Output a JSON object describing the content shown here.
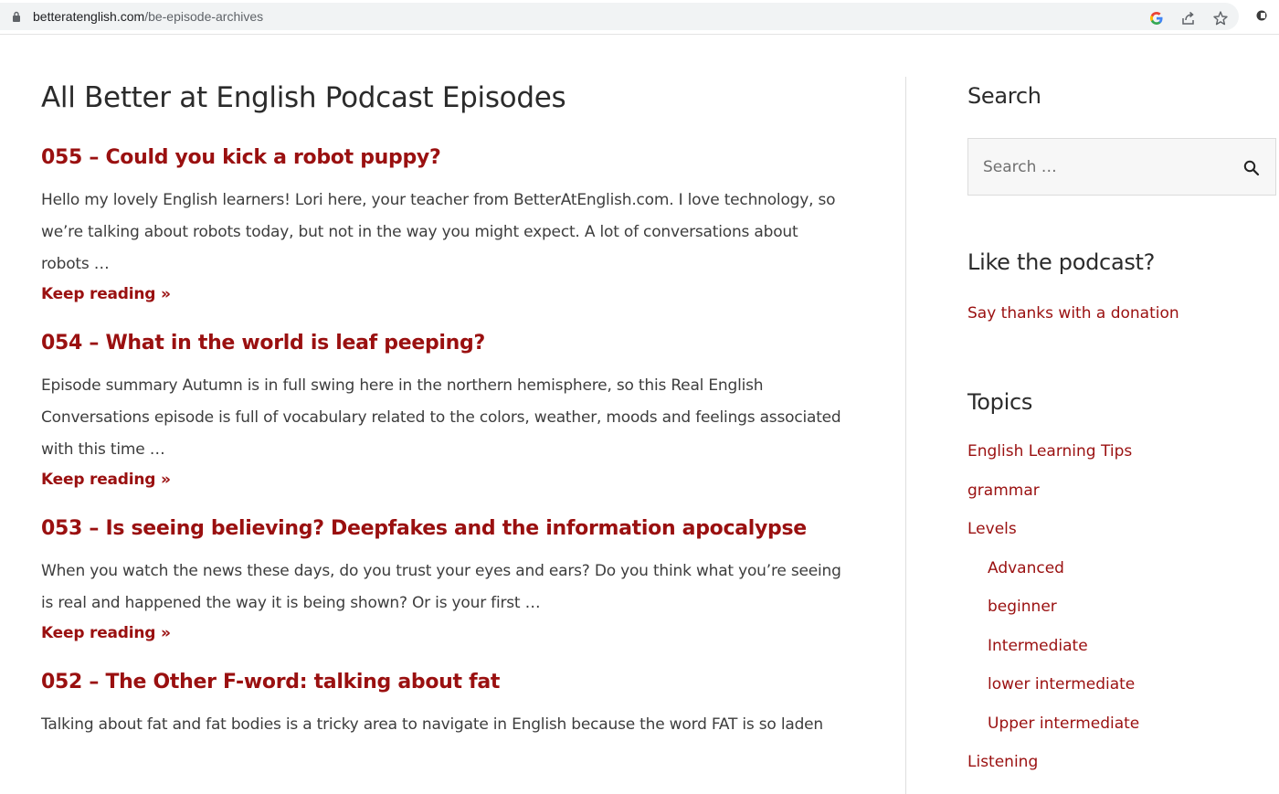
{
  "browser": {
    "url_domain": "betteratenglish.com",
    "url_path": "/be-episode-archives",
    "icons": [
      "lock-icon",
      "google-icon",
      "share-icon",
      "star-icon",
      "extension-icon"
    ]
  },
  "main": {
    "title": "All Better at English Podcast Episodes",
    "episodes": [
      {
        "title": "055 – Could you kick a robot puppy?",
        "excerpt": "Hello my lovely English learners! Lori here, your teacher from BetterAtEnglish.com. I love technology, so we’re talking about robots today, but not in the way you might expect. A lot of conversations about robots …",
        "more": "Keep reading »"
      },
      {
        "title": "054 – What in the world is leaf peeping?",
        "excerpt": "Episode summary Autumn is in full swing here in the northern hemisphere, so this Real English Conversations episode is full of vocabulary related to the colors, weather, moods and feelings associated with this time …",
        "more": "Keep reading »"
      },
      {
        "title": "053 – Is seeing believing? Deepfakes and the information apocalypse",
        "excerpt": "When you watch the news these days, do you trust your eyes and ears? Do you think what you’re seeing is real and happened the way it is being shown? Or is your first …",
        "more": "Keep reading »"
      },
      {
        "title": "052 – The Other F-word: talking about fat",
        "excerpt": "Talking about fat and fat bodies is a tricky area to navigate in English because the word FAT is so laden",
        "more": ""
      }
    ]
  },
  "sidebar": {
    "search": {
      "title": "Search",
      "placeholder": "Search …"
    },
    "like": {
      "title": "Like the podcast?",
      "link": "Say thanks with a donation"
    },
    "topics": {
      "title": "Topics",
      "items": [
        {
          "label": "English Learning Tips",
          "level": 0
        },
        {
          "label": "grammar",
          "level": 0
        },
        {
          "label": "Levels",
          "level": 0
        },
        {
          "label": "Advanced",
          "level": 1
        },
        {
          "label": "beginner",
          "level": 1
        },
        {
          "label": "Intermediate",
          "level": 1
        },
        {
          "label": "lower intermediate",
          "level": 1
        },
        {
          "label": "Upper intermediate",
          "level": 1
        },
        {
          "label": "Listening",
          "level": 0
        }
      ]
    }
  },
  "colors": {
    "link": "#9a1010",
    "text": "#3d3d3d",
    "heading": "#2b2b2b"
  }
}
